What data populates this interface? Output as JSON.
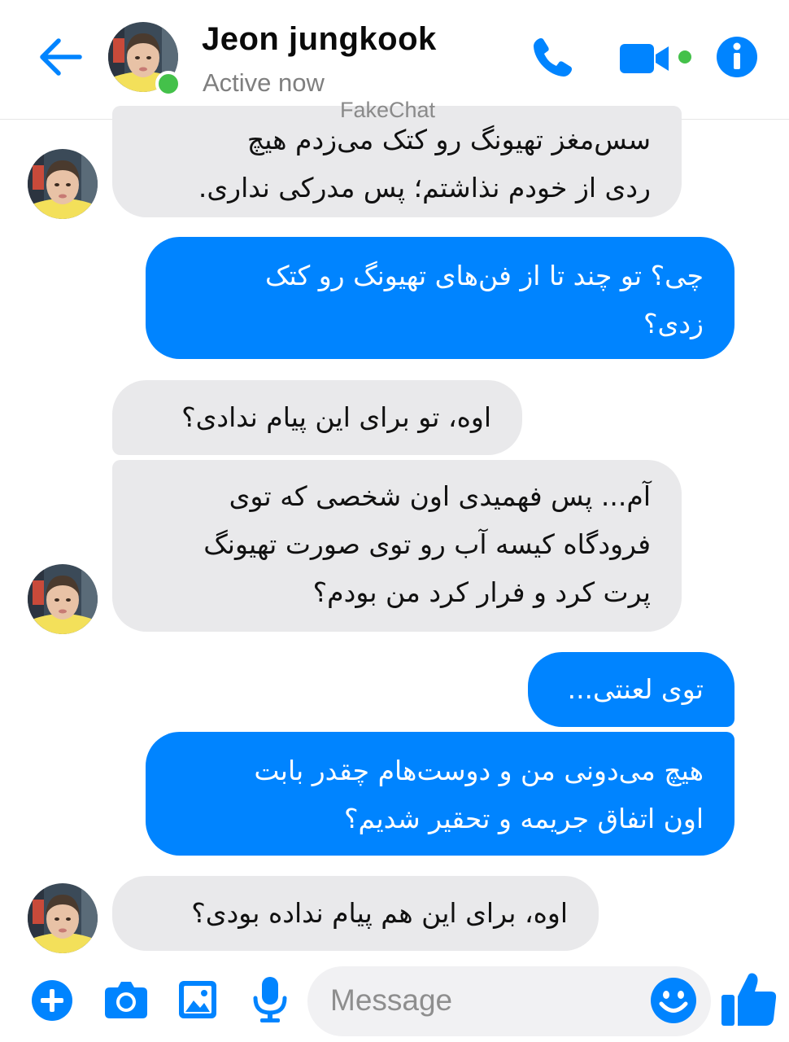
{
  "header": {
    "contact_name": "Jeon jungkook",
    "status": "Active now",
    "watermark": "FakeChat",
    "icons": [
      "back-arrow-icon",
      "phone-icon",
      "video-camera-icon",
      "info-icon"
    ]
  },
  "colors": {
    "accent": "#0084ff",
    "online": "#44c14a",
    "incoming_bubble": "#e9e9eb",
    "outgoing_bubble": "#0084ff"
  },
  "messages": [
    {
      "from": "contact",
      "lines": "سس‌مغز تهیونگ رو کتک می‌زدم هیچ\nردی از خودم نذاشتم؛ پس مدرکی نداری."
    },
    {
      "from": "me",
      "lines": "چی؟ تو چند تا از فن‌های تهیونگ رو کتک\nزدی؟"
    },
    {
      "from": "contact",
      "lines": "اوه، تو برای این پیام ندادی؟"
    },
    {
      "from": "contact",
      "lines": "آم... پس فهمیدی اون شخصی که توی\nفرودگاه کیسه آب رو توی صورت تهیونگ\nپرت کرد و فرار کرد من بودم؟"
    },
    {
      "from": "me",
      "lines": "توی لعنتی..."
    },
    {
      "from": "me",
      "lines": "هیچ می‌دونی من و دوست‌هام چقدر بابت\nاون اتفاق جریمه و تحقیر شدیم؟"
    },
    {
      "from": "contact",
      "lines": "اوه، برای این هم پیام نداده بودی؟"
    }
  ],
  "composer": {
    "placeholder": "Message",
    "icons": [
      "plus-icon",
      "camera-icon",
      "image-icon",
      "microphone-icon",
      "emoji-icon",
      "thumbs-up-icon"
    ]
  }
}
